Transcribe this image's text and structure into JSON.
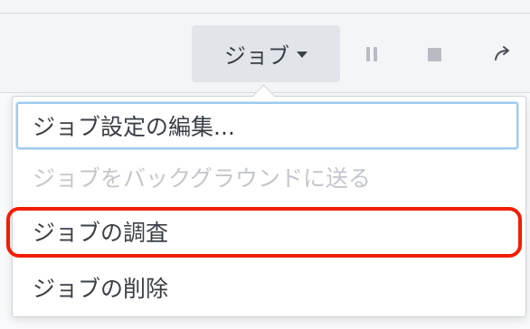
{
  "toolbar": {
    "job_button_label": "ジョブ",
    "icons": [
      "chevron-down-icon",
      "pause-icon",
      "stop-icon",
      "redo-icon"
    ]
  },
  "menu": {
    "items": [
      {
        "label": "ジョブ設定の編集...",
        "state": "focused"
      },
      {
        "label": "ジョブをバックグラウンドに送る",
        "state": "disabled"
      },
      {
        "label": "ジョブの調査",
        "state": "highlighted"
      },
      {
        "label": "ジョブの削除",
        "state": "normal"
      }
    ]
  },
  "colors": {
    "highlight": "#f21d00",
    "focus_border": "#9ecbee",
    "disabled_text": "#c3c7cc",
    "text": "#3a3f45"
  }
}
